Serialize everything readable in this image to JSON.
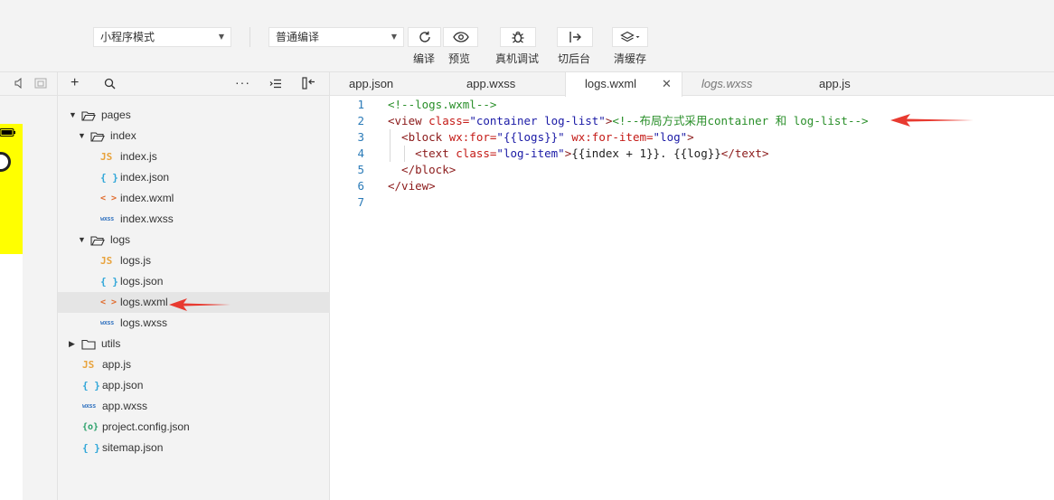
{
  "toolbar": {
    "mode_select": "小程序模式",
    "compile_select": "普通编译",
    "buttons": [
      {
        "label": "编译",
        "icon": "refresh-icon"
      },
      {
        "label": "预览",
        "icon": "eye-icon"
      },
      {
        "label": "真机调试",
        "icon": "bug-icon"
      },
      {
        "label": "切后台",
        "icon": "switch-background-icon"
      },
      {
        "label": "清缓存",
        "icon": "layers-icon"
      }
    ]
  },
  "explorer": {
    "tree": [
      {
        "name": "pages",
        "type": "folder",
        "expanded": true,
        "depth": 0
      },
      {
        "name": "index",
        "type": "folder",
        "expanded": true,
        "depth": 1
      },
      {
        "name": "index.js",
        "type": "js",
        "depth": 2
      },
      {
        "name": "index.json",
        "type": "json",
        "depth": 2
      },
      {
        "name": "index.wxml",
        "type": "wxml",
        "depth": 2
      },
      {
        "name": "index.wxss",
        "type": "wxss",
        "depth": 2
      },
      {
        "name": "logs",
        "type": "folder",
        "expanded": true,
        "depth": 1
      },
      {
        "name": "logs.js",
        "type": "js",
        "depth": 2
      },
      {
        "name": "logs.json",
        "type": "json",
        "depth": 2
      },
      {
        "name": "logs.wxml",
        "type": "wxml",
        "depth": 2,
        "selected": true
      },
      {
        "name": "logs.wxss",
        "type": "wxss",
        "depth": 2
      },
      {
        "name": "utils",
        "type": "folder",
        "expanded": false,
        "depth": 0
      },
      {
        "name": "app.js",
        "type": "js",
        "depth": 0
      },
      {
        "name": "app.json",
        "type": "json",
        "depth": 0
      },
      {
        "name": "app.wxss",
        "type": "wxss",
        "depth": 0
      },
      {
        "name": "project.config.json",
        "type": "cfg",
        "depth": 0
      },
      {
        "name": "sitemap.json",
        "type": "json",
        "depth": 0
      }
    ],
    "icon_glyphs": {
      "js": "JS",
      "json": "{ }",
      "wxml": "< >",
      "wxss": "wxss",
      "cfg": "{o}"
    }
  },
  "editor": {
    "tabs": [
      {
        "label": "app.json"
      },
      {
        "label": "app.wxss"
      },
      {
        "label": "logs.wxml",
        "active": true,
        "close": "✕"
      },
      {
        "label": "logs.wxss",
        "italic": true
      },
      {
        "label": "app.js"
      }
    ],
    "lines": [
      {
        "num": "1",
        "tokens": [
          {
            "t": "<!--logs.wxml-->",
            "c": "cm"
          }
        ]
      },
      {
        "num": "2",
        "tokens": [
          {
            "t": "<view ",
            "c": "tg"
          },
          {
            "t": "class=",
            "c": "at"
          },
          {
            "t": "\"container log-list\"",
            "c": "st"
          },
          {
            "t": ">",
            "c": "tg"
          },
          {
            "t": "<!--布局方式采用container 和 log-list-->",
            "c": "cm"
          }
        ]
      },
      {
        "num": "3",
        "tokens": [
          {
            "t": "  <block ",
            "c": "tg"
          },
          {
            "t": "wx:for=",
            "c": "at"
          },
          {
            "t": "\"{{logs}}\"",
            "c": "st"
          },
          {
            "t": " wx:for-item=",
            "c": "at"
          },
          {
            "t": "\"log\"",
            "c": "st"
          },
          {
            "t": ">",
            "c": "tg"
          }
        ]
      },
      {
        "num": "4",
        "tokens": [
          {
            "t": "    <text ",
            "c": "tg"
          },
          {
            "t": "class=",
            "c": "at"
          },
          {
            "t": "\"log-item\"",
            "c": "st"
          },
          {
            "t": ">",
            "c": "tg"
          },
          {
            "t": "{{index + 1}}. {{log}}",
            "c": "tx"
          },
          {
            "t": "</text>",
            "c": "tg"
          }
        ]
      },
      {
        "num": "5",
        "tokens": [
          {
            "t": "  </block>",
            "c": "tg"
          }
        ]
      },
      {
        "num": "6",
        "tokens": [
          {
            "t": "</view>",
            "c": "tg"
          }
        ]
      },
      {
        "num": "7",
        "tokens": []
      }
    ]
  },
  "colors": {
    "annotation_arrow": "#e83a30",
    "simulator_yellow": "#ffff00",
    "line_number": "#2b7bb8"
  }
}
